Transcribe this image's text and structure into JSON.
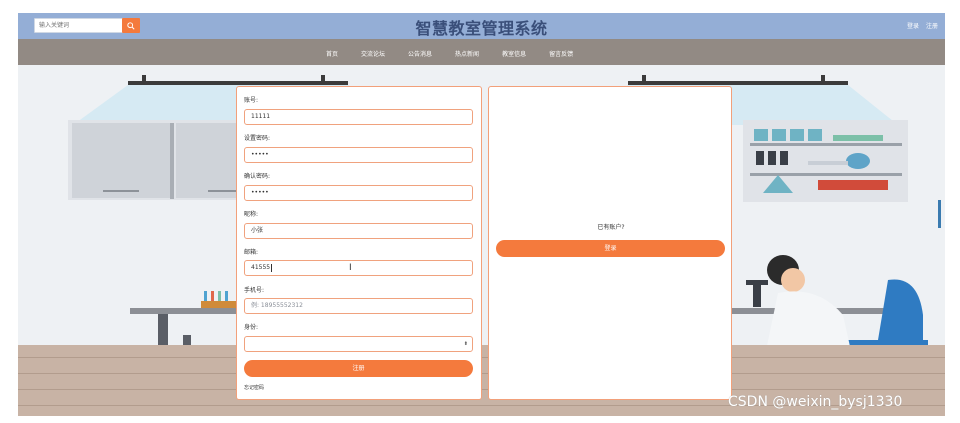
{
  "header": {
    "search_placeholder": "输入关键词",
    "site_title": "智慧教室管理系统",
    "login_link": "登录",
    "register_link": "注册"
  },
  "nav": {
    "items": [
      "首页",
      "交流论坛",
      "公告消息",
      "热点新闻",
      "教室信息",
      "留言反馈"
    ]
  },
  "register_form": {
    "account_label": "账号:",
    "account_value": "11111",
    "password_label": "设置密码:",
    "password_value": "•••••",
    "confirm_label": "确认密码:",
    "confirm_value": "•••••",
    "nickname_label": "昵称:",
    "nickname_value": "小张",
    "email_label": "邮箱:",
    "email_value": "41555",
    "phone_label": "手机号:",
    "phone_placeholder": "例: 18955552312",
    "role_label": "身份:",
    "role_value": "",
    "register_button": "注册",
    "forgot_link": "忘记密码"
  },
  "login_panel": {
    "have_account_text": "已有账户?",
    "login_button": "登录"
  },
  "watermark": "CSDN @weixin_bysj1330",
  "colors": {
    "topbar": "#94aed6",
    "navbar": "#928a84",
    "accent": "#f47a3d",
    "title": "#3a4f7a",
    "field_border": "#f0a27e"
  },
  "icons": {
    "search": "magnifier-icon",
    "select": "updown-arrow-icon"
  }
}
